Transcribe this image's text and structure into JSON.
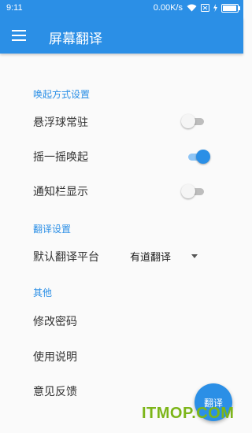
{
  "statusbar": {
    "time": "9:11",
    "speed": "0.00K/s"
  },
  "appbar": {
    "title": "屏幕翻译",
    "menu_icon": "hamburger-icon"
  },
  "sections": {
    "wake": {
      "title": "唤起方式设置",
      "floating_ball": {
        "label": "悬浮球常驻",
        "enabled": false
      },
      "shake": {
        "label": "摇一摇唤起",
        "enabled": true
      },
      "notification": {
        "label": "通知栏显示",
        "enabled": false
      }
    },
    "translate": {
      "title": "翻译设置",
      "platform_label": "默认翻译平台",
      "platform_value": "有道翻译"
    },
    "other": {
      "title": "其他",
      "change_password": "修改密码",
      "instructions": "使用说明",
      "feedback": "意见反馈"
    }
  },
  "fab": {
    "label": "翻译"
  },
  "watermark": "ITMOP.COM",
  "colors": {
    "accent": "#2b8fe6",
    "watermark": "#7cb518"
  }
}
